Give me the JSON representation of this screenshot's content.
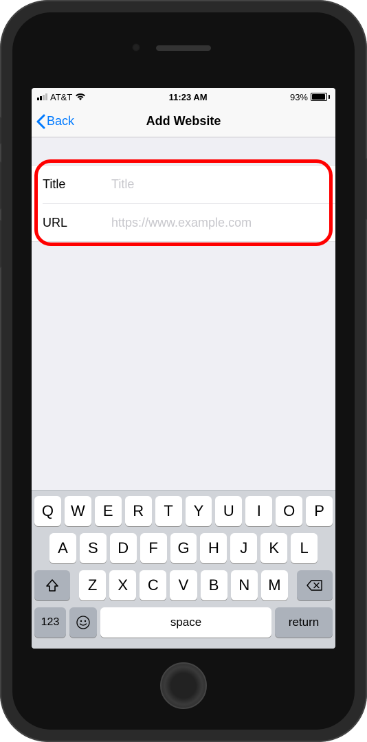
{
  "status": {
    "carrier": "AT&T",
    "time": "11:23 AM",
    "battery_pct": "93%",
    "battery_fill": 93
  },
  "nav": {
    "back_label": "Back",
    "title": "Add Website"
  },
  "form": {
    "title": {
      "label": "Title",
      "placeholder": "Title",
      "value": ""
    },
    "url": {
      "label": "URL",
      "placeholder": "https://www.example.com",
      "value": ""
    }
  },
  "keyboard": {
    "row1": [
      "Q",
      "W",
      "E",
      "R",
      "T",
      "Y",
      "U",
      "I",
      "O",
      "P"
    ],
    "row2": [
      "A",
      "S",
      "D",
      "F",
      "G",
      "H",
      "J",
      "K",
      "L"
    ],
    "row3": [
      "Z",
      "X",
      "C",
      "V",
      "B",
      "N",
      "M"
    ],
    "numkey": "123",
    "space": "space",
    "return": "return"
  }
}
